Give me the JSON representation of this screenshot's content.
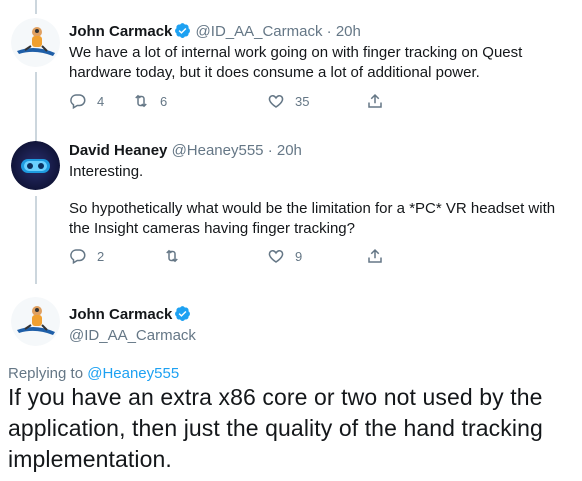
{
  "tweets": [
    {
      "name": "John Carmack",
      "handle": "@ID_AA_Carmack",
      "separator": "·",
      "time": "20h",
      "text": "We have a lot of internal work going on with finger tracking on Quest hardware today, but it does consume a lot of additional power.",
      "replies": "4",
      "retweets": "6",
      "likes": "35"
    },
    {
      "name": "David Heaney",
      "handle": "@Heaney555",
      "separator": "·",
      "time": "20h",
      "text_line1": "Interesting.",
      "text_line2": "So hypothetically what would be the limitation for a *PC* VR headset with the Insight cameras having finger tracking?",
      "replies": "2",
      "retweets": "",
      "likes": "9"
    }
  ],
  "main_tweet": {
    "name": "John Carmack",
    "handle": "@ID_AA_Carmack",
    "replying_prefix": "Replying to",
    "replying_handle": "@Heaney555",
    "text": "If you have an extra x86 core or two not used by the application, then just the quality of the hand tracking implementation."
  },
  "icons": {
    "reply": "reply-icon",
    "retweet": "retweet-icon",
    "like": "heart-icon",
    "share": "share-icon",
    "verified": "verified-badge-icon"
  },
  "colors": {
    "accent": "#1da1f2",
    "secondary_text": "#657786",
    "thread_line": "#ccd6dd"
  }
}
